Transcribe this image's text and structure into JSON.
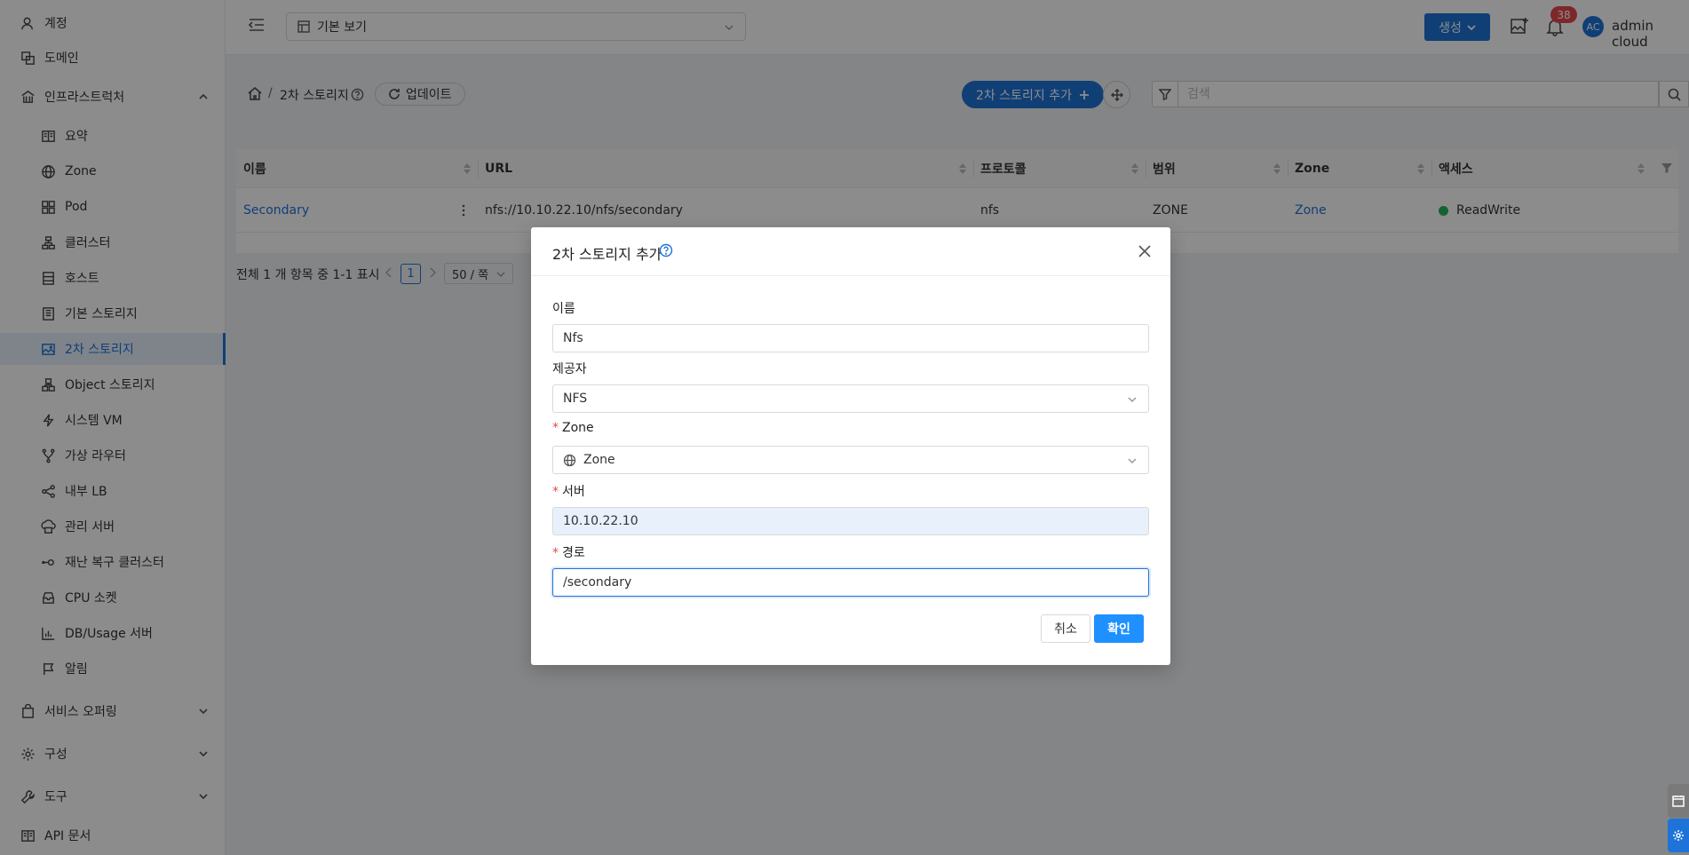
{
  "sidebar": {
    "account": "계정",
    "domain": "도메인",
    "infrastructure": "인프라스트럭처",
    "sub_items": [
      "요약",
      "Zone",
      "Pod",
      "클러스터",
      "호스트",
      "기본 스토리지",
      "2차 스토리지",
      "Object 스토리지",
      "시스템 VM",
      "가상 라우터",
      "내부 LB",
      "관리 서버",
      "재난 복구 클러스터",
      "CPU 소켓",
      "DB/Usage 서버",
      "알림"
    ],
    "service_offering": "서비스 오퍼링",
    "configuration": "구성",
    "tools": "도구",
    "api_docs": "API 문서"
  },
  "header": {
    "view_select": "기본 보기",
    "create_label": "생성",
    "notification_count": "38",
    "avatar_initials": "AC",
    "user_name": "admin cloud"
  },
  "breadcrumb": {
    "separator": "/",
    "current": "2차 스토리지",
    "refresh_label": "업데이트",
    "add_label": "2차 스토리지 추가",
    "search_placeholder": "검색"
  },
  "table": {
    "columns": [
      "이름",
      "URL",
      "프로토콜",
      "범위",
      "Zone",
      "액세스"
    ],
    "rows": [
      {
        "name": "Secondary",
        "url": "nfs://10.10.22.10/nfs/secondary",
        "protocol": "nfs",
        "scope": "ZONE",
        "zone": "Zone",
        "access": "ReadWrite"
      }
    ]
  },
  "pagination": {
    "summary": "전체 1 개 항목 중 1-1 표시",
    "current_page": "1",
    "page_size": "50 / 쪽"
  },
  "modal": {
    "title": "2차 스토리지 추가",
    "name_label": "이름",
    "name_value": "Nfs",
    "provider_label": "제공자",
    "provider_value": "NFS",
    "zone_label": "Zone",
    "zone_value": "Zone",
    "server_label": "서버",
    "server_value": "10.10.22.10",
    "path_label": "경로",
    "path_value": "/secondary",
    "required_mark": "*",
    "cancel_label": "취소",
    "ok_label": "확인"
  },
  "colors": {
    "primary": "#1e73d8",
    "status_ok": "#27b35a",
    "badge": "#e5484d"
  }
}
